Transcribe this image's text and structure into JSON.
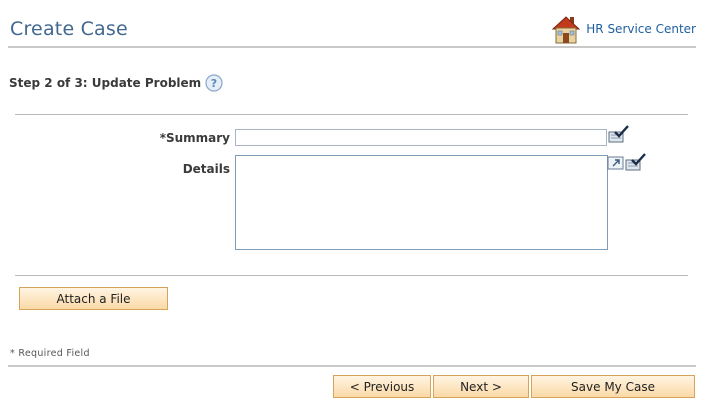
{
  "header": {
    "title": "Create Case",
    "home_link_label": "HR Service Center"
  },
  "step": {
    "title": "Step 2 of 3: Update Problem"
  },
  "form": {
    "summary_label": "*Summary",
    "summary_value": "",
    "details_label": "Details",
    "details_value": ""
  },
  "buttons": {
    "attach": "Attach a File",
    "previous": "< Previous",
    "next": "Next >",
    "save": "Save My Case"
  },
  "footer": {
    "required_note": "* Required Field"
  },
  "icons": {
    "home": "house-icon",
    "help": "help-icon",
    "spell_check": "spell-check-icon",
    "expand": "expand-icon"
  },
  "colors": {
    "title": "#41678f",
    "link": "#1f5fa0",
    "button_fill": "#fbd9a6",
    "button_border": "#d5a35c"
  }
}
